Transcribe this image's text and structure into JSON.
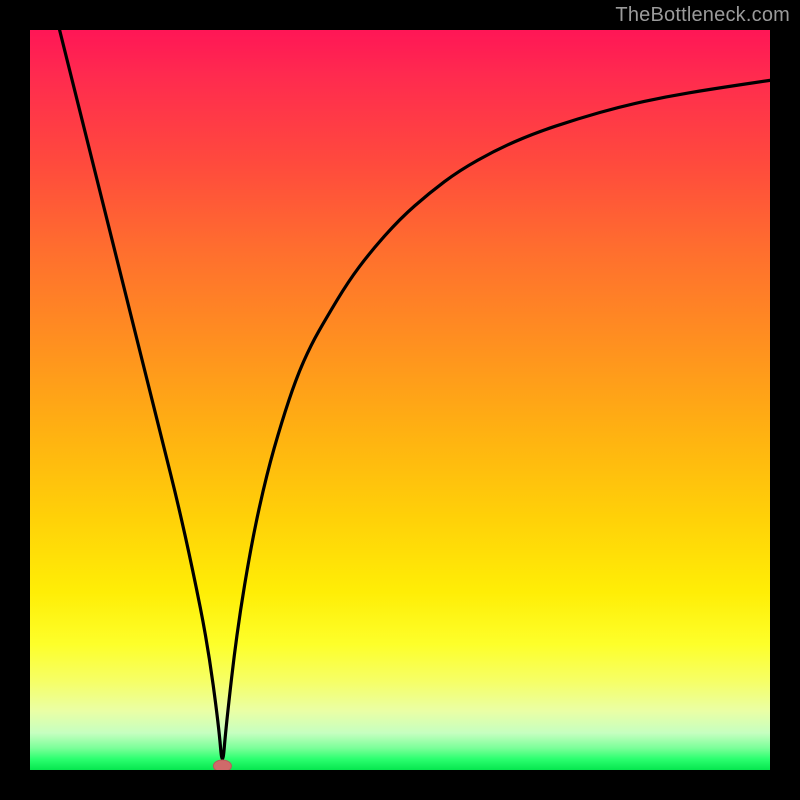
{
  "watermark": "TheBottleneck.com",
  "chart_data": {
    "type": "line",
    "title": "",
    "xlabel": "",
    "ylabel": "",
    "xlim": [
      0,
      100
    ],
    "ylim": [
      0,
      100
    ],
    "grid": false,
    "legend": false,
    "background": "heat-gradient",
    "minimum_marker": {
      "x": 26,
      "y": 0
    },
    "series": [
      {
        "name": "bottleneck-curve",
        "color": "#000000",
        "x": [
          4,
          6,
          8,
          10,
          12,
          14,
          16,
          18,
          20,
          22,
          24,
          25.5,
          26,
          26.5,
          28,
          30,
          32,
          34,
          36,
          38,
          40,
          43,
          46,
          50,
          54,
          58,
          63,
          68,
          74,
          80,
          86,
          92,
          100
        ],
        "values": [
          100,
          92,
          84,
          76,
          68,
          60,
          52,
          44,
          36,
          27,
          17,
          6,
          0,
          6,
          19,
          31,
          40,
          47,
          53,
          57.5,
          61,
          66,
          70,
          74.5,
          78,
          81,
          83.8,
          86,
          88,
          89.7,
          91,
          92,
          93.2
        ]
      }
    ]
  }
}
